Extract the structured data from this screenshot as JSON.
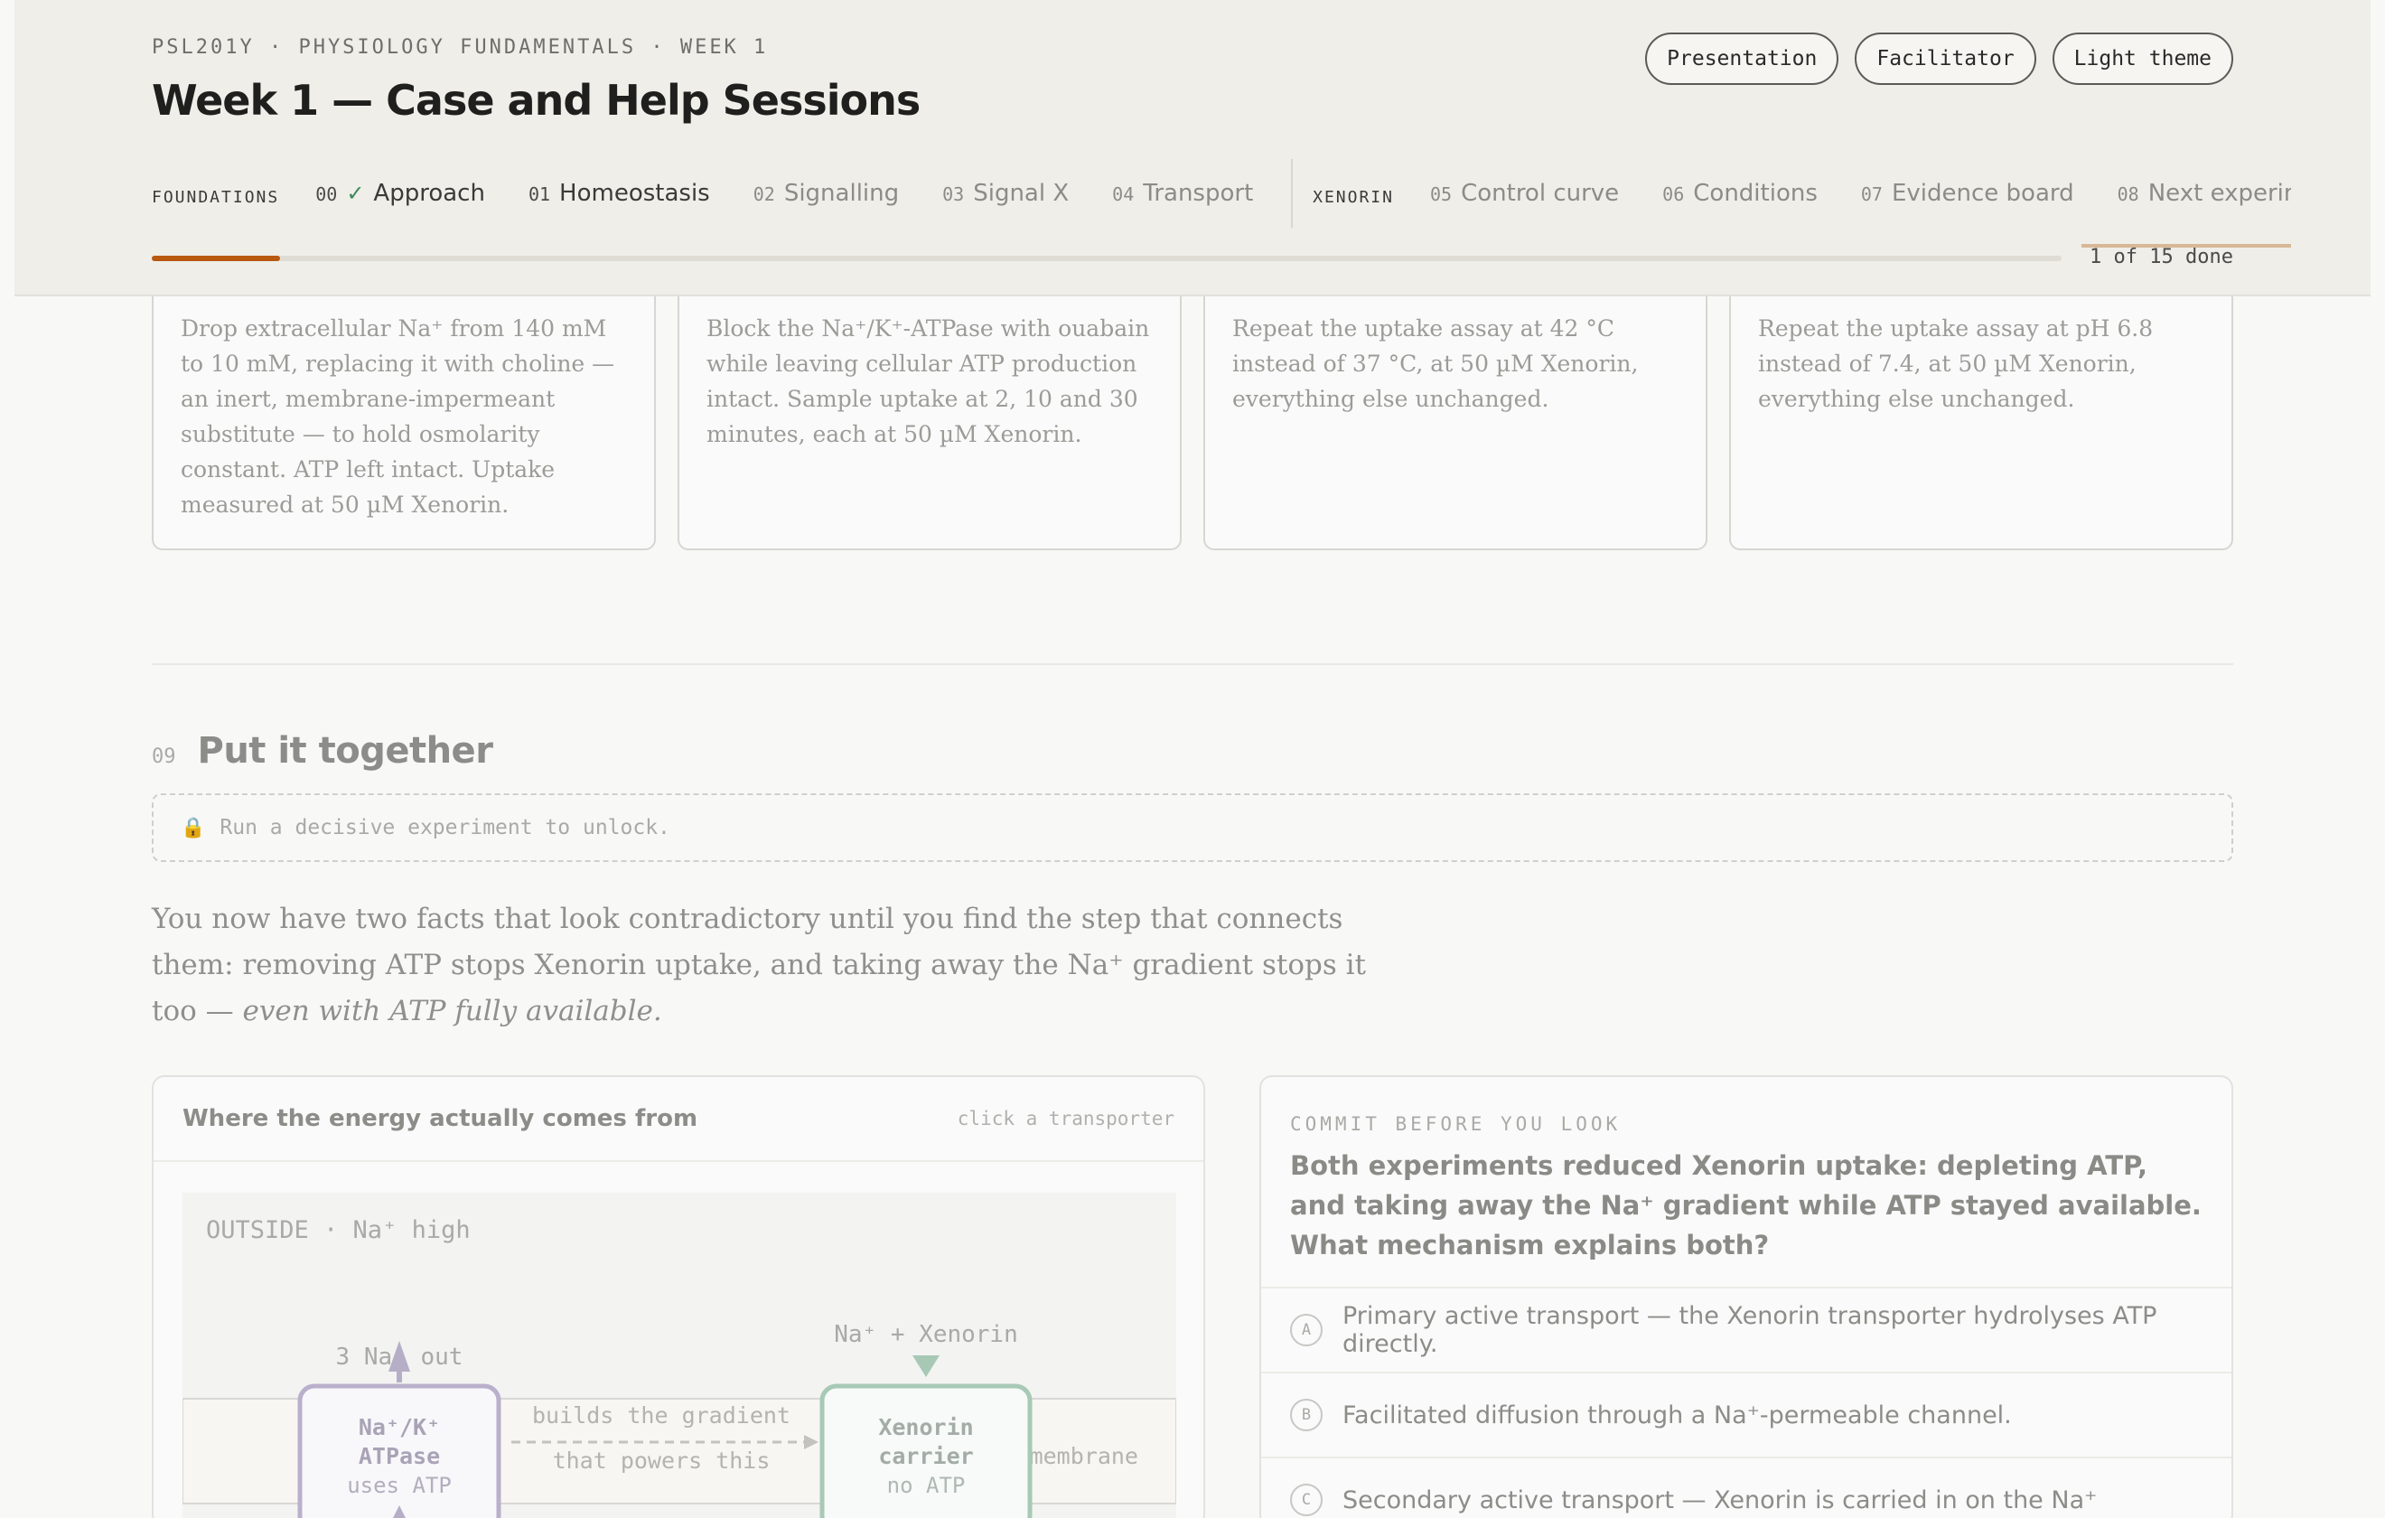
{
  "header": {
    "breadcrumb": "PSL201Y · PHYSIOLOGY FUNDAMENTALS · WEEK 1",
    "title": "Week 1 — Case and Help Sessions",
    "buttons": {
      "presentation": "Presentation",
      "facilitator": "Facilitator",
      "theme": "Light theme"
    },
    "groups": {
      "foundations": "FOUNDATIONS",
      "xenorin": "XENORIN"
    },
    "tabs": [
      {
        "num": "00",
        "label": "Approach",
        "done": true
      },
      {
        "num": "01",
        "label": "Homeostasis"
      },
      {
        "num": "02",
        "label": "Signalling"
      },
      {
        "num": "03",
        "label": "Signal X"
      },
      {
        "num": "04",
        "label": "Transport"
      },
      {
        "num": "05",
        "label": "Control curve"
      },
      {
        "num": "06",
        "label": "Conditions"
      },
      {
        "num": "07",
        "label": "Evidence board"
      },
      {
        "num": "08",
        "label": "Next experiment"
      }
    ],
    "progress": {
      "done": 1,
      "total": 15,
      "label": "1 of 15 done",
      "fraction": 0.067
    },
    "colors": {
      "accent": "#b9580f",
      "check": "#3c8a5a"
    }
  },
  "experiments": [
    "Drop extracellular Na⁺ from 140 mM to 10 mM, replacing it with choline — an inert, membrane-impermeant substitute — to hold osmolarity constant. ATP left intact. Uptake measured at 50 µM Xenorin.",
    "Block the Na⁺/K⁺-ATPase with ouabain while leaving cellular ATP production intact. Sample uptake at 2, 10 and 30 minutes, each at 50 µM Xenorin.",
    "Repeat the uptake assay at 42 °C instead of 37 °C, at 50 µM Xenorin, everything else unchanged.",
    "Repeat the uptake assay at pH 6.8 instead of 7.4, at 50 µM Xenorin, everything else unchanged."
  ],
  "section": {
    "num": "09",
    "title": "Put it together",
    "locked_text": "Run a decisive experiment to unlock.",
    "intro_plain": "You now have two facts that look contradictory until you find the step that connects them: removing ATP stops Xenorin uptake, and taking away the Na⁺ gradient stops it too — ",
    "intro_em": "even with ATP fully available."
  },
  "energy_panel": {
    "title": "Where the energy actually comes from",
    "hint": "click a transporter",
    "outside": "OUTSIDE · Na⁺ high",
    "pump_out": "3 Na⁺ out",
    "pump_lines": [
      "Na⁺/K⁺",
      "ATPase",
      "uses ATP"
    ],
    "link_lines": [
      "builds the gradient",
      "that powers this"
    ],
    "carrier_top": "Na⁺ + Xenorin",
    "carrier_lines": [
      "Xenorin",
      "carrier",
      "no ATP"
    ],
    "membrane": "membrane"
  },
  "question": {
    "kicker": "COMMIT BEFORE YOU LOOK",
    "text": "Both experiments reduced Xenorin uptake: depleting ATP, and taking away the Na⁺ gradient while ATP stayed available. What mechanism explains both?",
    "options": [
      {
        "letter": "A",
        "label": "Primary active transport — the Xenorin transporter hydrolyses ATP directly."
      },
      {
        "letter": "B",
        "label": "Facilitated diffusion through a Na⁺-permeable channel."
      },
      {
        "letter": "C",
        "label": "Secondary active transport — Xenorin is carried in on the Na⁺"
      }
    ]
  }
}
